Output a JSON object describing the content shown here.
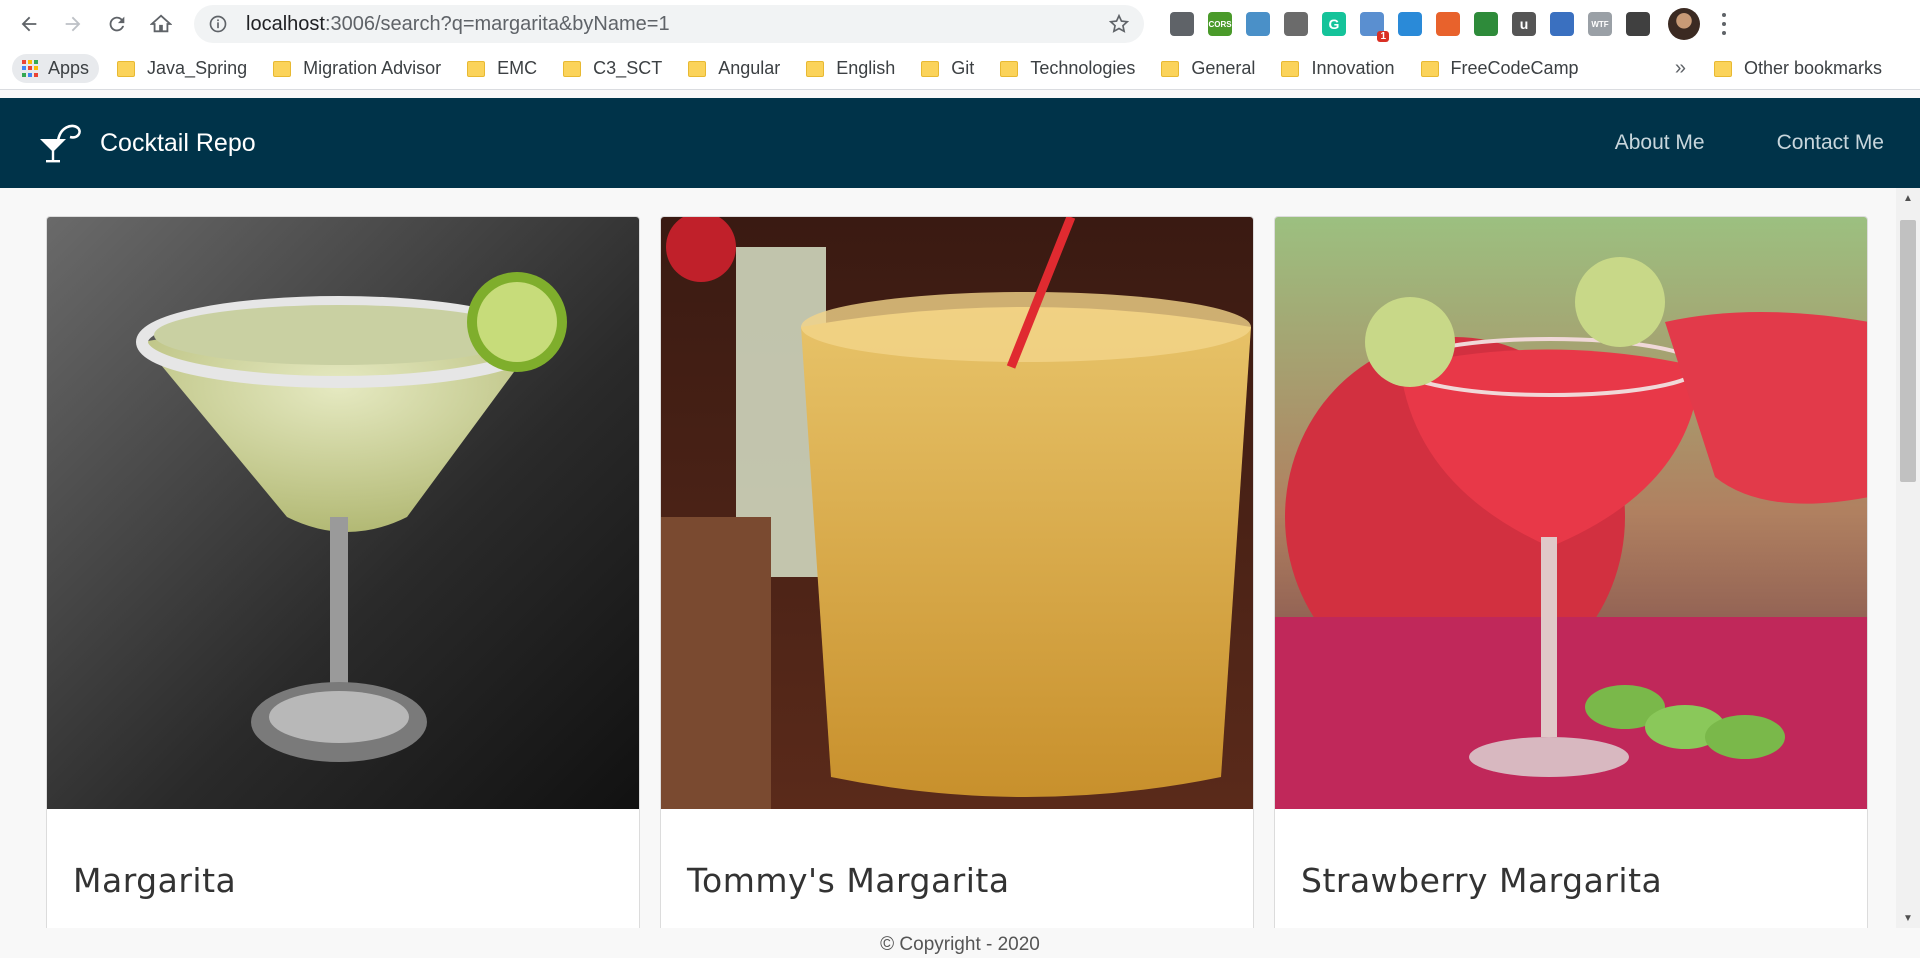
{
  "browser": {
    "url_host": "localhost",
    "url_rest": ":3006/search?q=margarita&byName=1",
    "bookmarks": [
      {
        "label": "Apps",
        "type": "apps"
      },
      {
        "label": "Java_Spring",
        "type": "folder"
      },
      {
        "label": "Migration Advisor",
        "type": "folder"
      },
      {
        "label": "EMC",
        "type": "folder"
      },
      {
        "label": "C3_SCT",
        "type": "folder"
      },
      {
        "label": "Angular",
        "type": "folder"
      },
      {
        "label": "English",
        "type": "folder"
      },
      {
        "label": "Git",
        "type": "folder"
      },
      {
        "label": "Technologies",
        "type": "folder"
      },
      {
        "label": "General",
        "type": "folder"
      },
      {
        "label": "Innovation",
        "type": "folder"
      },
      {
        "label": "FreeCodeCamp",
        "type": "folder"
      }
    ],
    "more_bookmarks": "»",
    "other_bookmarks": "Other bookmarks",
    "extensions": [
      {
        "name": "record-extension-icon",
        "color": "#5f6368",
        "text": ""
      },
      {
        "name": "cors-extension-icon",
        "color": "#4a9a2a",
        "text": "CORS"
      },
      {
        "name": "satellite-extension-icon",
        "color": "#4a90c8",
        "text": ""
      },
      {
        "name": "refresh-extension-icon",
        "color": "#6b6b6b",
        "text": ""
      },
      {
        "name": "grammarly-extension-icon",
        "color": "#15c39a",
        "text": "G"
      },
      {
        "name": "network-extension-icon",
        "color": "#5a8fd0",
        "text": "",
        "badge": "1"
      },
      {
        "name": "windows-extension-icon",
        "color": "#2a8ad8",
        "text": ""
      },
      {
        "name": "rocket-extension-icon",
        "color": "#e8622c",
        "text": ""
      },
      {
        "name": "sheets-extension-icon",
        "color": "#2e8b3a",
        "text": ""
      },
      {
        "name": "u-extension-icon",
        "color": "#555555",
        "text": "u"
      },
      {
        "name": "camera-extension-icon",
        "color": "#3a70c0",
        "text": ""
      },
      {
        "name": "wtf-extension-icon",
        "color": "#9aa0a6",
        "text": "WTF"
      },
      {
        "name": "dark-mode-extension-icon",
        "color": "#404040",
        "text": ""
      }
    ]
  },
  "app": {
    "brand": "Cocktail Repo",
    "nav": {
      "about": "About Me",
      "contact": "Contact Me"
    },
    "cards": [
      {
        "title": "Margarita"
      },
      {
        "title": "Tommy's Margarita"
      },
      {
        "title": "Strawberry Margarita"
      }
    ],
    "footer": "© Copyright - 2020"
  }
}
